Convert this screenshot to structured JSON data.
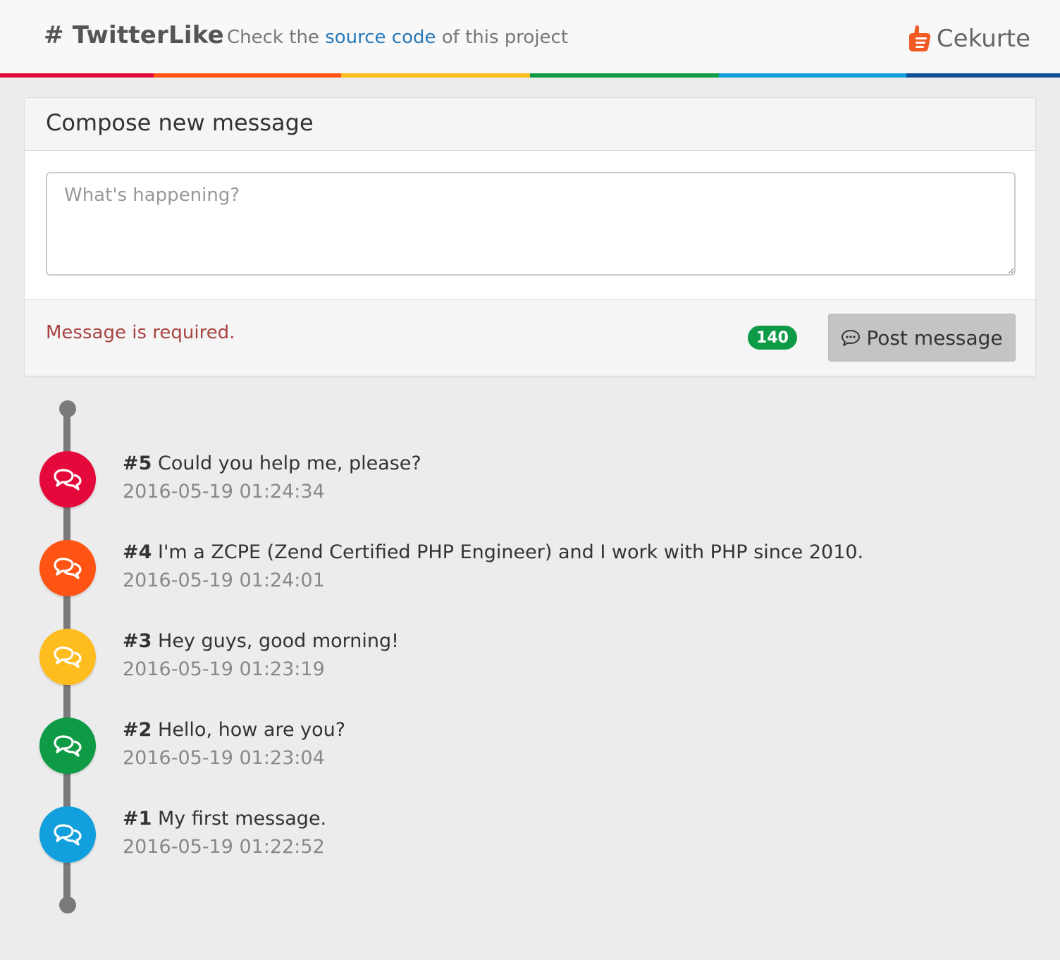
{
  "header": {
    "brand": "# TwitterLike",
    "tagline_prefix": "Check the ",
    "tagline_link": "source code",
    "tagline_suffix": " of this project",
    "logo_text": "Cekurte"
  },
  "stripe_colors": [
    "#e4093a",
    "#ff5414",
    "#ffbc1e",
    "#0f9b46",
    "#129fdd",
    "#0f4d95"
  ],
  "compose": {
    "title": "Compose new message",
    "placeholder": "What's happening?",
    "error": "Message is required.",
    "counter": "140",
    "post_label": "Post message"
  },
  "timeline": [
    {
      "id": "#5",
      "text": "Could you help me, please?",
      "date": "2016-05-19 01:24:34",
      "color": "#e4093a"
    },
    {
      "id": "#4",
      "text": "I'm a ZCPE (Zend Certified PHP Engineer) and I work with PHP since 2010.",
      "date": "2016-05-19 01:24:01",
      "color": "#ff5414"
    },
    {
      "id": "#3",
      "text": "Hey guys, good morning!",
      "date": "2016-05-19 01:23:19",
      "color": "#ffbc1e"
    },
    {
      "id": "#2",
      "text": "Hello, how are you?",
      "date": "2016-05-19 01:23:04",
      "color": "#0f9b46"
    },
    {
      "id": "#1",
      "text": "My first message.",
      "date": "2016-05-19 01:22:52",
      "color": "#129fdd"
    }
  ]
}
